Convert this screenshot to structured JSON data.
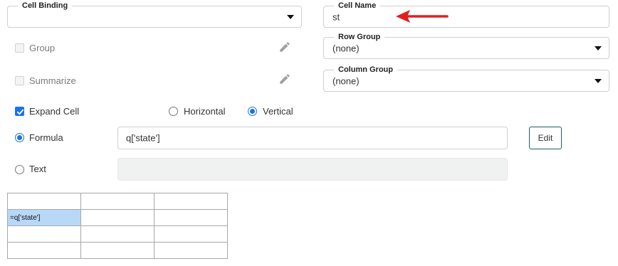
{
  "cell_binding": {
    "legend": "Cell Binding",
    "value": ""
  },
  "cell_name": {
    "legend": "Cell Name",
    "value": "st"
  },
  "row_group": {
    "legend": "Row Group",
    "value": "(none)"
  },
  "column_group": {
    "legend": "Column Group",
    "value": "(none)"
  },
  "group": {
    "label": "Group",
    "checked": false,
    "disabled": true
  },
  "summarize": {
    "label": "Summarize",
    "checked": false,
    "disabled": true
  },
  "expand_cell": {
    "label": "Expand Cell",
    "checked": true
  },
  "orientation": {
    "horizontal_label": "Horizontal",
    "vertical_label": "Vertical",
    "selected": "Vertical"
  },
  "formula": {
    "label": "Formula",
    "value": "q['state']",
    "selected": true
  },
  "text": {
    "label": "Text",
    "value": "",
    "selected": false
  },
  "edit_button": {
    "label": "Edit"
  },
  "grid": {
    "rows": [
      [
        "",
        "",
        ""
      ],
      [
        "=q['state']",
        "",
        ""
      ],
      [
        "",
        "",
        ""
      ],
      [
        "",
        "",
        ""
      ]
    ],
    "selected_cell": [
      1,
      0
    ]
  },
  "colors": {
    "accent": "#1a73e8",
    "arrow": "#e02020",
    "selected_cell": "#b8d8f8"
  },
  "icons": [
    "pencil-icon",
    "chevron-down-icon",
    "red-arrow-icon",
    "check-icon"
  ]
}
